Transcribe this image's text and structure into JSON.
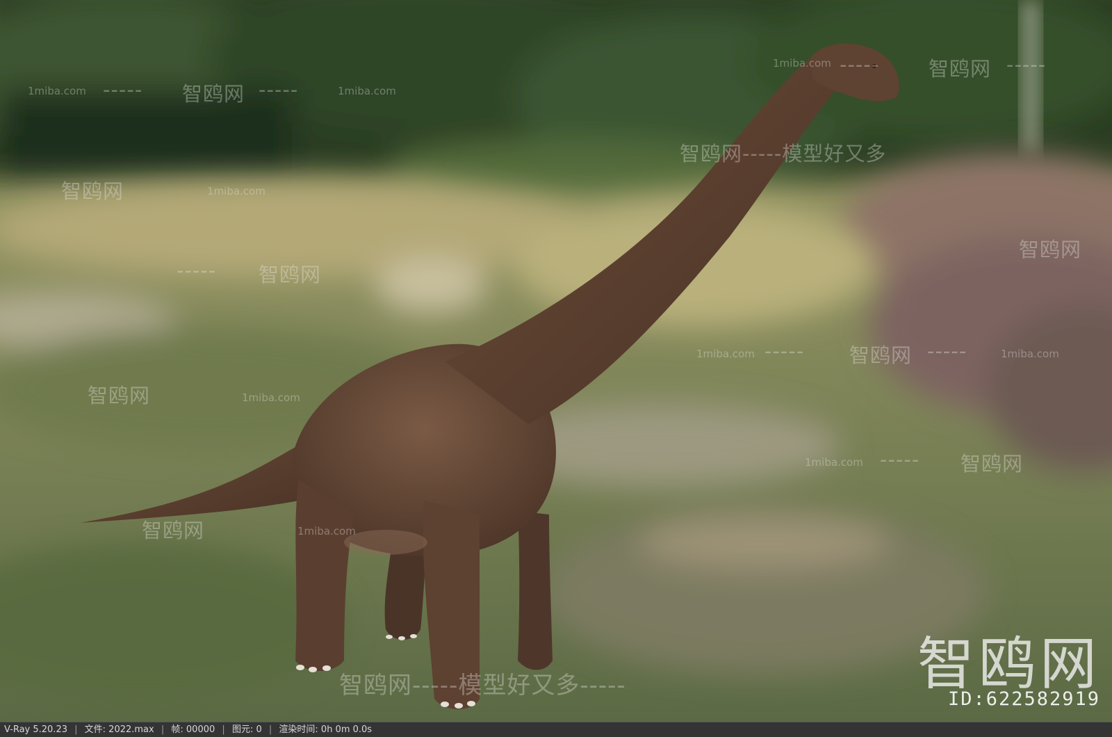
{
  "scene": {
    "subject": "brachiosaurus-model",
    "background": "blurred-forest-meadow",
    "colors": {
      "forest": "#243a1f",
      "meadow": "#9a9a62",
      "heather": "#8a6f72",
      "dino_skin": "#5a4030"
    }
  },
  "watermarks": {
    "site_cn": "智鸥网",
    "site_url": "1miba.com",
    "dash_line": "-----",
    "slogan_line": "智鸥网-----模型好又多-----",
    "slogan_short": "智鸥网-----模型好又多",
    "big_logo": "智鸥网",
    "id_label": "ID:622582919"
  },
  "status_bar": {
    "renderer": "V-Ray 5.20.23",
    "file": "文件: 2022.max",
    "frame": "帧: 00000",
    "primitives": "图元: 0",
    "render_time": "渲染时间: 0h 0m 0.0s",
    "separator": "|"
  }
}
